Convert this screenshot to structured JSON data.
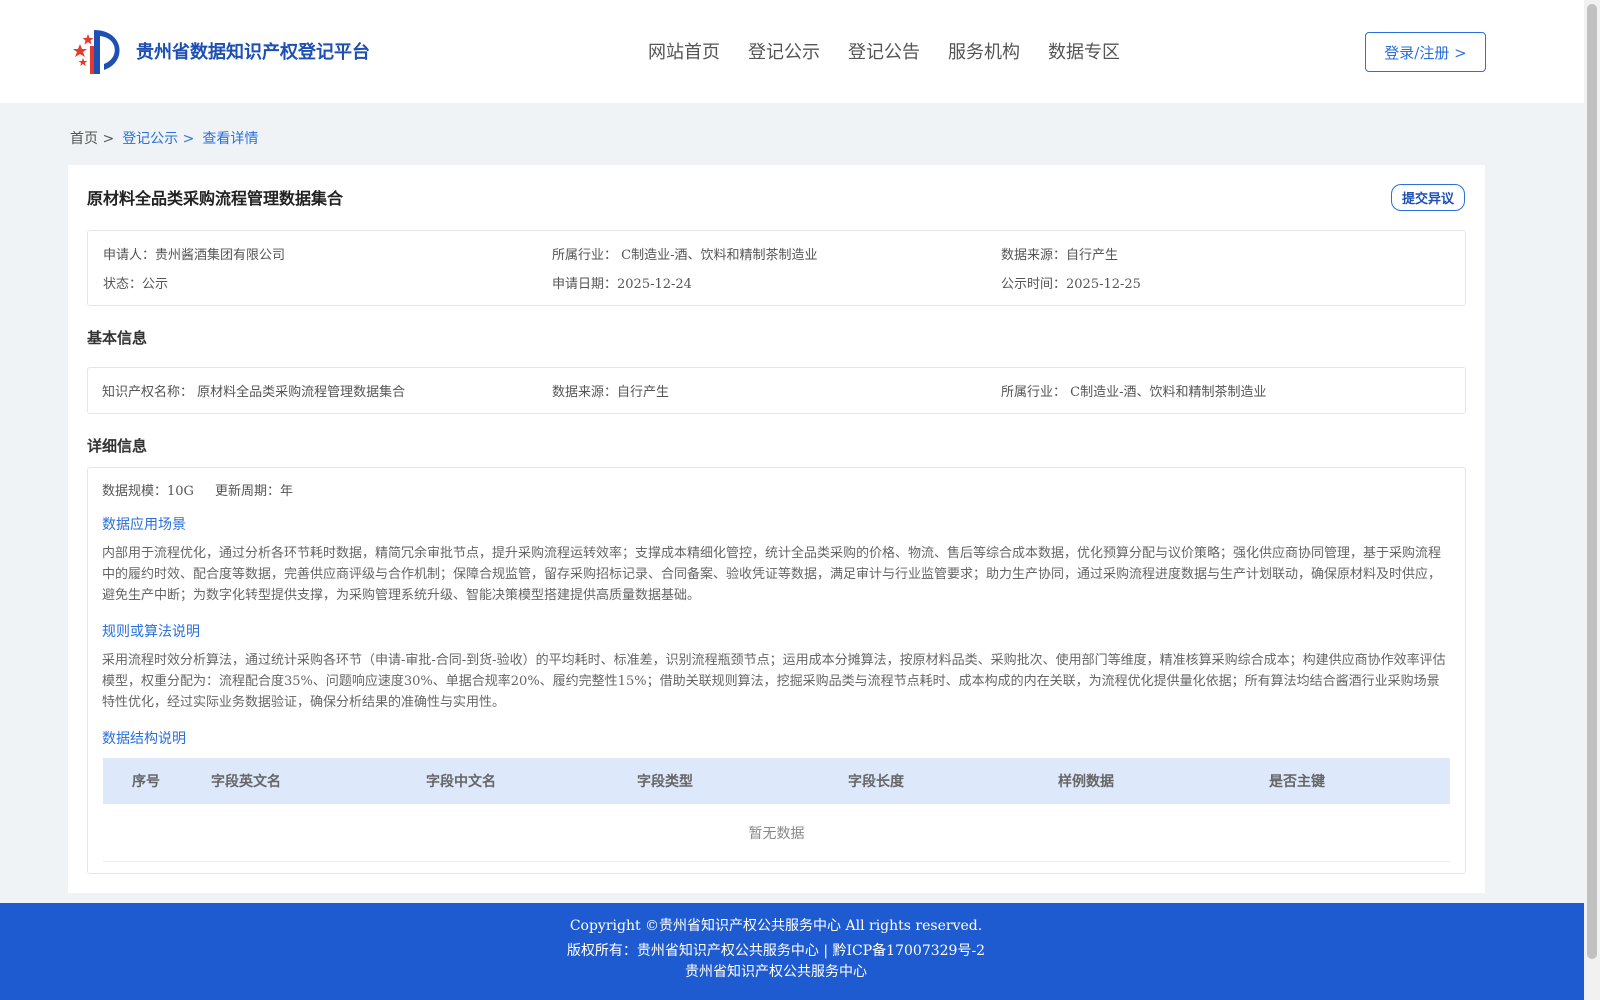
{
  "header": {
    "logo_text": "贵州省数据知识产权登记平台",
    "nav": [
      "网站首页",
      "登记公示",
      "登记公告",
      "服务机构",
      "数据专区"
    ],
    "login_label": "登录/注册 >"
  },
  "breadcrumb": {
    "home": "首页 >",
    "section": "登记公示 >",
    "current": "查看详情"
  },
  "detail": {
    "title": "原材料全品类采购流程管理数据集合",
    "objection_label": "提交异议",
    "summary": {
      "applicant": "申请人：贵州酱酒集团有限公司",
      "industry": "所属行业： C制造业-酒、饮料和精制茶制造业",
      "source": "数据来源：自行产生",
      "status": "状态：公示",
      "apply_date": "申请日期：2025-12-24",
      "publish_date": "公示时间：2025-12-25"
    },
    "basic": {
      "section_title": "基本信息",
      "ip_name": "知识产权名称： 原材料全品类采购流程管理数据集合",
      "source": "数据来源：自行产生",
      "industry": "所属行业： C制造业-酒、饮料和精制茶制造业"
    },
    "info": {
      "section_title": "详细信息",
      "scale": "数据规模：10G",
      "cycle": "更新周期：年",
      "scene_title": "数据应用场景",
      "scene_text": "内部用于流程优化，通过分析各环节耗时数据，精简冗余审批节点，提升采购流程运转效率；支撑成本精细化管控，统计全品类采购的价格、物流、售后等综合成本数据，优化预算分配与议价策略；强化供应商协同管理，基于采购流程中的履约时效、配合度等数据，完善供应商评级与合作机制；保障合规监管，留存采购招标记录、合同备案、验收凭证等数据，满足审计与行业监管要求；助力生产协同，通过采购流程进度数据与生产计划联动，确保原材料及时供应，避免生产中断；为数字化转型提供支撑，为采购管理系统升级、智能决策模型搭建提供高质量数据基础。",
      "rule_title": "规则或算法说明",
      "rule_text": "采用流程时效分析算法，通过统计采购各环节（申请-审批-合同-到货-验收）的平均耗时、标准差，识别流程瓶颈节点；运用成本分摊算法，按原材料品类、采购批次、使用部门等维度，精准核算采购综合成本；构建供应商协作效率评估模型，权重分配为：流程配合度35%、问题响应速度30%、单据合规率20%、履约完整性15%；借助关联规则算法，挖掘采购品类与流程节点耗时、成本构成的内在关联，为流程优化提供量化依据；所有算法均结合酱酒行业采购场景特性优化，经过实际业务数据验证，确保分析结果的准确性与实用性。",
      "struct_title": "数据结构说明",
      "table_headers": [
        "序号",
        "字段英文名",
        "字段中文名",
        "字段类型",
        "字段长度",
        "样例数据",
        "是否主键"
      ],
      "empty_text": "暂无数据"
    }
  },
  "footer": {
    "copyright": "Copyright ©贵州省知识产权公共服务中心 All rights reserved.",
    "owner": "版权所有：贵州省知识产权公共服务中心 | 黔ICP备17007329号-2",
    "org": "贵州省知识产权公共服务中心"
  },
  "colors": {
    "accent": "#2a6fdb",
    "footer_bg": "#1f5bd0",
    "table_head_bg": "#dde9fb"
  }
}
